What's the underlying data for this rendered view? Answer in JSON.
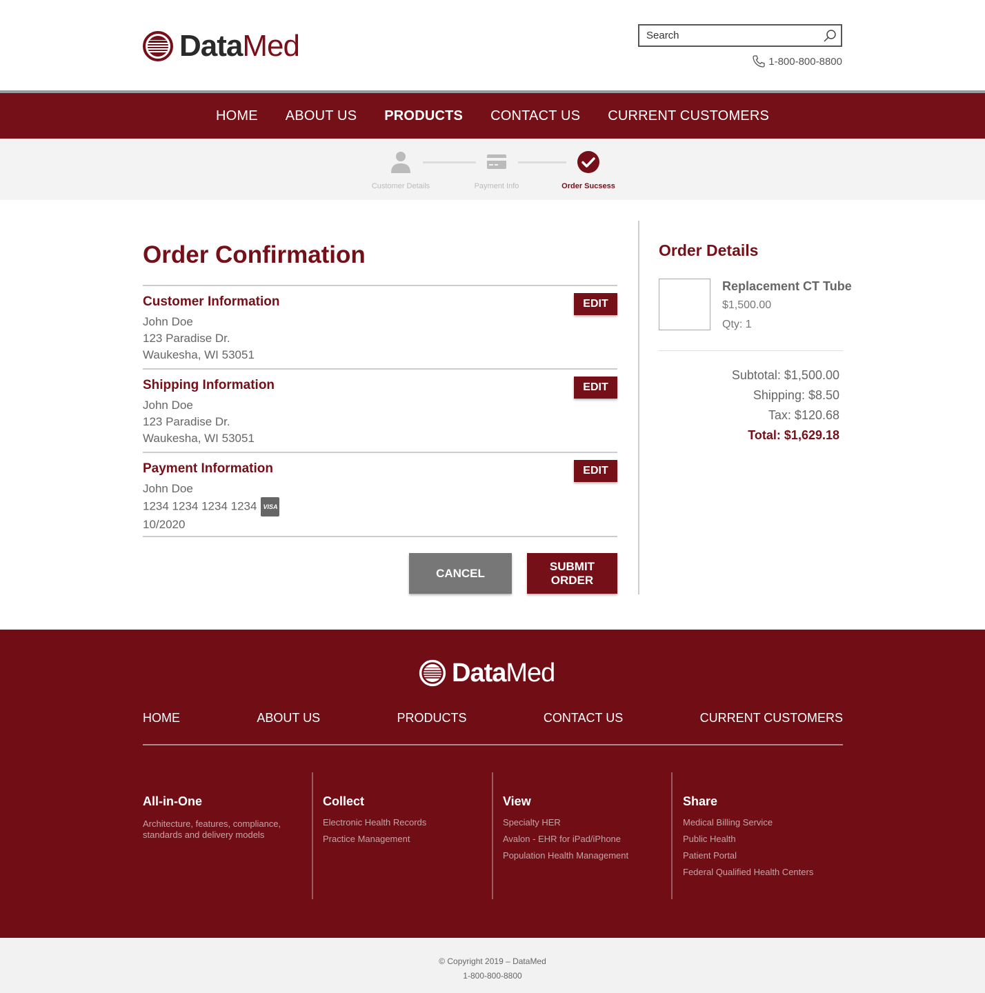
{
  "brand": {
    "name_bold": "Data",
    "name_light": "Med",
    "color": "#751019"
  },
  "search": {
    "placeholder": "Search"
  },
  "phone": "1-800-800-8800",
  "nav": [
    "HOME",
    "ABOUT US",
    "PRODUCTS",
    "CONTACT US",
    "CURRENT CUSTOMERS"
  ],
  "nav_active": "PRODUCTS",
  "steps": [
    {
      "label": "Customer Details",
      "icon": "user-icon"
    },
    {
      "label": "Payment Info",
      "icon": "credit-card-icon"
    },
    {
      "label": "Order Sucsess",
      "icon": "check-circle-icon"
    }
  ],
  "page_title": "Order Confirmation",
  "edit_label": "EDIT",
  "customer": {
    "heading": "Customer Information",
    "name": "John Doe",
    "street": "123 Paradise Dr.",
    "city": "Waukesha, WI 53051"
  },
  "shipping": {
    "heading": "Shipping Information",
    "name": "John Doe",
    "street": "123 Paradise Dr.",
    "city": "Waukesha, WI 53051"
  },
  "payment": {
    "heading": "Payment Information",
    "name": "John Doe",
    "card": "1234 1234 1234 1234",
    "card_brand": "VISA",
    "expiry": "10/2020"
  },
  "buttons": {
    "cancel": "CANCEL",
    "submit_line1": "SUBMIT",
    "submit_line2": "ORDER"
  },
  "order": {
    "title": "Order Details",
    "product": {
      "name": "Replacement CT Tube",
      "price": "$1,500.00",
      "qty": "Qty: 1"
    },
    "subtotal": "Subtotal: $1,500.00",
    "shipping": "Shipping: $8.50",
    "tax": "Tax: $120.68",
    "total": "Total: $1,629.18"
  },
  "footer": {
    "nav": [
      "HOME",
      "ABOUT US",
      "PRODUCTS",
      "CONTACT US",
      "CURRENT CUSTOMERS"
    ],
    "columns": [
      {
        "heading": "All-in-One",
        "desc": "Architecture, features, compliance, standards and delivery models"
      },
      {
        "heading": "Collect",
        "links": [
          "Electronic Health Records",
          "Practice Management"
        ]
      },
      {
        "heading": "View",
        "links": [
          "Specialty HER",
          "Avalon - EHR for iPad/iPhone",
          "Population Health Management"
        ]
      },
      {
        "heading": "Share",
        "links": [
          "Medical Billing Service",
          "Public Health",
          "Patient Portal",
          "Federal Qualified Health Centers"
        ]
      }
    ],
    "copyright": "© Copyright 2019 – DataMed",
    "phone": "1-800-800-8800"
  }
}
